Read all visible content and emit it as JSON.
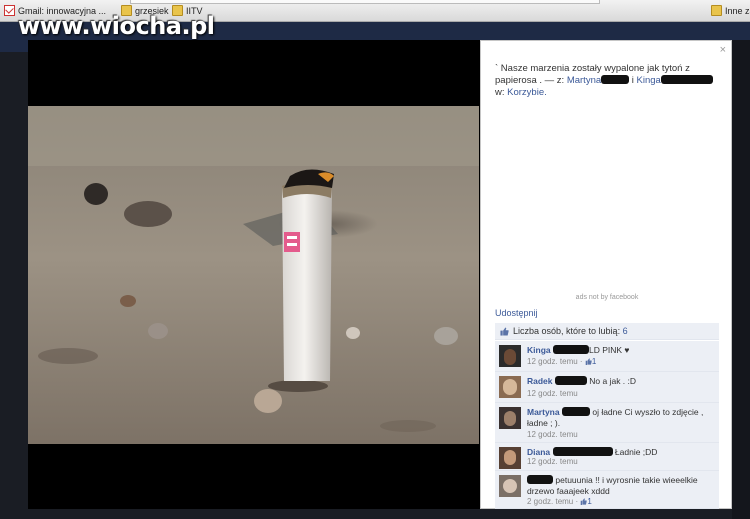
{
  "watermark": "www.wiocha.pl",
  "bookmarks": [
    {
      "label": "Gmail: innowacyjna ...",
      "icon": "gmail-icon"
    },
    {
      "label": "grzesiek",
      "icon": "folder-icon"
    },
    {
      "label": "IITV",
      "icon": "folder-icon"
    },
    {
      "label": "Inne za",
      "icon": "folder-icon"
    }
  ],
  "panel": {
    "close": "×",
    "caption_text": "` Nasze marzenia zostały wypalone jak tytoń z papierosa . — z:",
    "tag_1": "Martyna",
    "tag_sep": "i",
    "tag_2": "Kinga",
    "location_prefix": "w:",
    "location": "Korzybie.",
    "ads_note": "ads not by facebook",
    "share": "Udostępnij",
    "likes_label": "Liczba osób, które to lubią:",
    "likes_count": "6"
  },
  "comments": [
    {
      "name": "Kinga",
      "text": "LD PINK ♥",
      "time": "12 godz. temu",
      "likes": "1"
    },
    {
      "name": "Radek",
      "text": "No a jak . :D",
      "time": "12 godz. temu",
      "likes": ""
    },
    {
      "name": "Martyna",
      "text": "oj ładne Ci wyszło to zdjęcie , ładne ; ).",
      "time": "12 godz. temu",
      "likes": ""
    },
    {
      "name": "Diana",
      "text": "Ładnie ;DD",
      "time": "12 godz. temu",
      "likes": ""
    },
    {
      "name": "",
      "text": "petuuunia !! i wyrosnie takie wieeelkie drzewo faaajeek xddd",
      "time": "2 godz. temu",
      "likes": "1"
    }
  ],
  "colors": {
    "fb_link": "#3b5998",
    "panel_bg": "#ffffff",
    "backdrop": "#0b0b0b"
  }
}
